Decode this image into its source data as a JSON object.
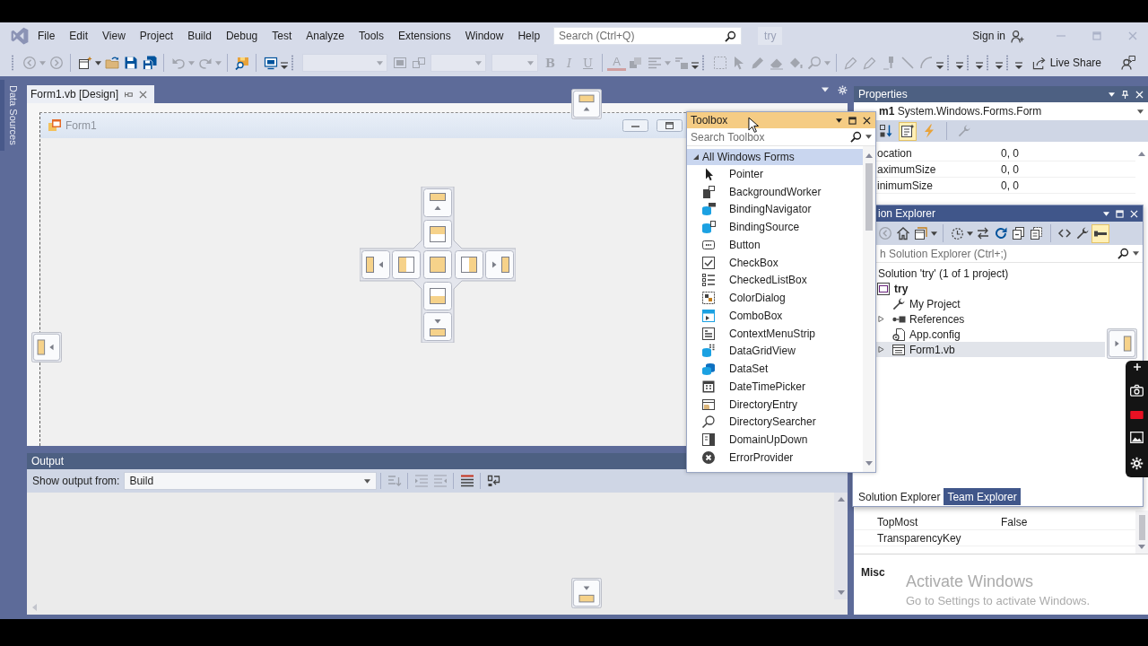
{
  "menu_bar": {
    "items": [
      "File",
      "Edit",
      "View",
      "Project",
      "Build",
      "Debug",
      "Test",
      "Analyze",
      "Tools",
      "Extensions",
      "Window",
      "Help"
    ],
    "search": {
      "placeholder": "Search (Ctrl+Q)"
    },
    "solution_name": "try",
    "sign_in": "Sign in"
  },
  "toolbar": {
    "bars": [
      {
        "kind": "full",
        "groups": [
          [
            {
              "kind": "back",
              "disabled": true
            },
            {
              "kind": "caret",
              "disabled": true
            },
            {
              "kind": "forward",
              "disabled": true
            }
          ],
          [
            {
              "kind": "newproj",
              "disabled": false
            },
            {
              "kind": "caret",
              "disabled": false
            },
            {
              "kind": "open",
              "disabled": false
            },
            {
              "kind": "save",
              "disabled": false
            },
            {
              "kind": "saveall",
              "disabled": false
            }
          ],
          [
            {
              "kind": "undo",
              "disabled": true
            },
            {
              "kind": "caret",
              "disabled": true
            },
            {
              "kind": "redo",
              "disabled": true
            },
            {
              "kind": "caret",
              "disabled": true
            }
          ],
          [
            {
              "kind": "find",
              "disabled": false
            }
          ],
          [
            {
              "kind": "monitor",
              "disabled": false
            }
          ]
        ]
      },
      {
        "kind": "full",
        "groups": [
          [
            {
              "kind": "combo",
              "disabled": true
            },
            {
              "kind": "frame",
              "disabled": true
            },
            {
              "kind": "squares",
              "disabled": true
            },
            {
              "kind": "combo",
              "disabled": true
            },
            {
              "kind": "combo",
              "disabled": true
            },
            {
              "kind": "bold",
              "label": "B",
              "disabled": true
            },
            {
              "kind": "italic",
              "label": "I",
              "disabled": true
            },
            {
              "kind": "underline",
              "label": "U",
              "disabled": true
            }
          ],
          [
            {
              "kind": "fontcolor",
              "label": "A",
              "disabled": true
            },
            {
              "kind": "stacked",
              "disabled": true
            },
            {
              "kind": "align",
              "disabled": true
            },
            {
              "kind": "caret",
              "disabled": true
            },
            {
              "kind": "textblock",
              "disabled": true
            }
          ]
        ]
      },
      {
        "kind": "full",
        "groups": [
          [
            {
              "kind": "dashsquare",
              "disabled": true
            },
            {
              "kind": "cursor",
              "disabled": true
            },
            {
              "kind": "pencil",
              "disabled": true
            },
            {
              "kind": "eraser",
              "disabled": true
            },
            {
              "kind": "bucket",
              "disabled": true
            },
            {
              "kind": "magnifier",
              "disabled": true
            },
            {
              "kind": "caret",
              "disabled": true
            }
          ],
          [
            {
              "kind": "pen",
              "disabled": true
            },
            {
              "kind": "pen",
              "disabled": true
            },
            {
              "kind": "brush",
              "disabled": true
            },
            {
              "kind": "line",
              "disabled": true
            },
            {
              "kind": "arc",
              "disabled": true
            }
          ]
        ]
      },
      {
        "kind": "collapsed"
      },
      {
        "kind": "collapsed"
      },
      {
        "kind": "collapsed"
      },
      {
        "kind": "collapsed"
      }
    ],
    "live_share": "Live Share"
  },
  "side_tabs": [
    "Data Sources"
  ],
  "document_tabs": [
    {
      "label": "Form1.vb [Design]",
      "selected": true
    }
  ],
  "designer": {
    "form_title": "Form1"
  },
  "output": {
    "title": "Output",
    "source_label": "Show output from:",
    "source": "Build",
    "toolbar": [
      [
        {
          "kind": "findmsg",
          "disabled": true
        }
      ],
      [
        {
          "kind": "prevmsg",
          "disabled": true
        },
        {
          "kind": "nextmsg",
          "disabled": true
        }
      ],
      [
        {
          "kind": "clear",
          "disabled": false
        }
      ],
      [
        {
          "kind": "wrap",
          "disabled": false
        }
      ]
    ]
  },
  "properties": {
    "title": "Properties",
    "selected_object": "**m1** System.Windows.Forms.Form",
    "toolbar": [
      [
        {
          "kind": "sort",
          "disabled": false,
          "selected": false
        },
        {
          "kind": "pages",
          "disabled": false,
          "selected": true
        },
        {
          "kind": "events",
          "disabled": false,
          "selected": false
        }
      ],
      [
        {
          "kind": "wrench",
          "disabled": true,
          "selected": false
        }
      ]
    ],
    "rows_top": [
      {
        "name": "ocation",
        "value": "0, 0"
      },
      {
        "name": "aximumSize",
        "value": "0, 0"
      },
      {
        "name": "inimumSize",
        "value": "0, 0"
      }
    ],
    "rows_bottom": [
      {
        "name": "TopMost",
        "value": "False"
      },
      {
        "name": "TransparencyKey"
      }
    ],
    "description_title": "Misc"
  },
  "toolbox": {
    "title": "Toolbox",
    "search": {
      "placeholder": "Search Toolbox"
    },
    "category": {
      "label": "All Windows Forms",
      "expanded": true,
      "selected": true
    },
    "items": [
      {
        "label": "Pointer",
        "kind": "pointer",
        "selected": false
      },
      {
        "label": "BackgroundWorker",
        "kind": "worker",
        "selected": false
      },
      {
        "label": "BindingNavigator",
        "kind": "navigator",
        "selected": false
      },
      {
        "label": "BindingSource",
        "kind": "source",
        "selected": false
      },
      {
        "label": "Button",
        "kind": "button",
        "selected": false
      },
      {
        "label": "CheckBox",
        "kind": "checkbox",
        "selected": false
      },
      {
        "label": "CheckedListBox",
        "kind": "checklist",
        "selected": false
      },
      {
        "label": "ColorDialog",
        "kind": "colordialog",
        "selected": false
      },
      {
        "label": "ComboBox",
        "kind": "combobox",
        "selected": false
      },
      {
        "label": "ContextMenuStrip",
        "kind": "menustrip",
        "selected": false
      },
      {
        "label": "DataGridView",
        "kind": "datagrid",
        "selected": false
      },
      {
        "label": "DataSet",
        "kind": "dataset",
        "selected": false
      },
      {
        "label": "DateTimePicker",
        "kind": "datepicker",
        "selected": false
      },
      {
        "label": "DirectoryEntry",
        "kind": "direntry",
        "selected": false
      },
      {
        "label": "DirectorySearcher",
        "kind": "dirsearch",
        "selected": false
      },
      {
        "label": "DomainUpDown",
        "kind": "updown",
        "selected": false
      },
      {
        "label": "ErrorProvider",
        "kind": "errorprovider",
        "selected": false
      }
    ]
  },
  "solution_explorer": {
    "title": "ion Explorer",
    "toolbar": [
      [
        {
          "kind": "back",
          "disabled": true,
          "selected": false
        },
        {
          "kind": "home",
          "disabled": false,
          "selected": false
        },
        {
          "kind": "views",
          "disabled": false,
          "selected": false
        },
        {
          "kind": "caret",
          "disabled": false,
          "selected": false
        }
      ],
      [
        {
          "kind": "clock",
          "disabled": false,
          "selected": false
        },
        {
          "kind": "caret",
          "disabled": false,
          "selected": false
        },
        {
          "kind": "sync",
          "disabled": false,
          "selected": false
        },
        {
          "kind": "refresh",
          "disabled": false,
          "selected": false
        },
        {
          "kind": "collapse",
          "disabled": false,
          "selected": false
        },
        {
          "kind": "showall",
          "disabled": false,
          "selected": false
        }
      ],
      [
        {
          "kind": "code",
          "disabled": false,
          "selected": false
        },
        {
          "kind": "wrench",
          "disabled": false,
          "selected": false
        },
        {
          "kind": "preview",
          "disabled": false,
          "selected": true
        }
      ]
    ],
    "search": {
      "placeholder": "h Solution Explorer (Ctrl+;)"
    },
    "tree": [
      {
        "label": "Solution 'try' (1 of 1 project)",
        "selected": false,
        "children": [
          {
            "label": "try",
            "kind": "project",
            "selected": false,
            "children": [
              {
                "label": "My Project",
                "kind": "properties",
                "selected": false
              },
              {
                "label": "References",
                "kind": "references",
                "selected": false,
                "expanded": false
              },
              {
                "label": "App.config",
                "kind": "config",
                "selected": false
              },
              {
                "label": "Form1.vb",
                "kind": "form",
                "selected": true,
                "expanded": false
              }
            ]
          }
        ]
      }
    ],
    "tabs": [
      {
        "label": "Solution Explorer",
        "selected": true
      },
      {
        "label": "Team Explorer",
        "selected": false
      }
    ]
  },
  "activation_notice": {
    "title": "Activate Windows",
    "subtitle": "Go to Settings to activate Windows."
  }
}
